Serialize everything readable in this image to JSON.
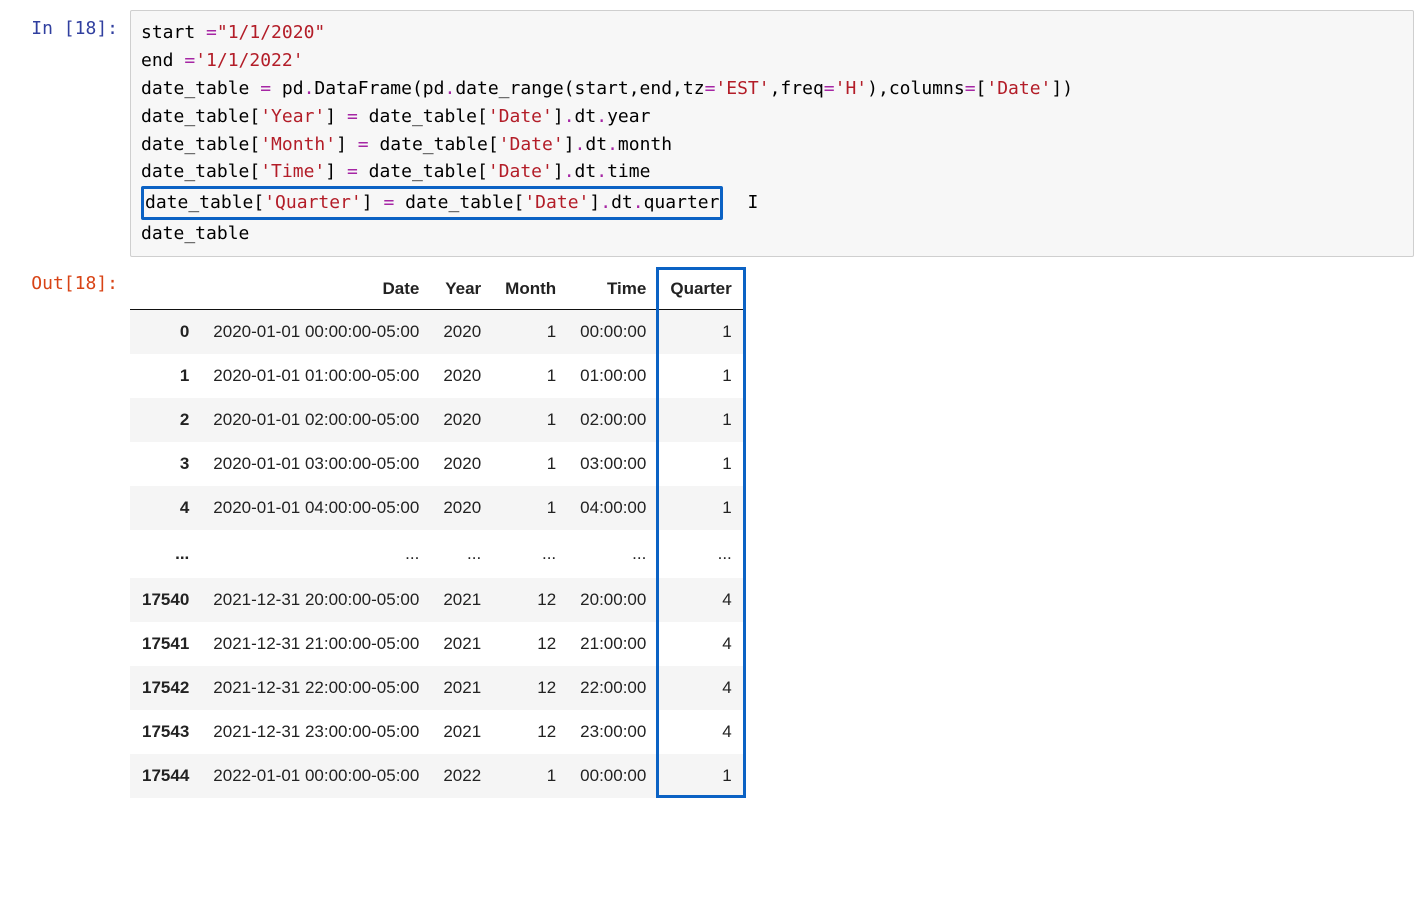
{
  "cell": {
    "exec_count": "18",
    "in_prefix": "In [",
    "in_suffix": "]:",
    "out_prefix": "Out[",
    "out_suffix": "]:"
  },
  "code": {
    "l1_a": "start ",
    "l1_b": "=",
    "l1_c": "\"1/1/2020\"",
    "l2_a": "end ",
    "l2_b": "=",
    "l2_c": "'1/1/2022'",
    "l3_a": "date_table ",
    "l3_b": "=",
    "l3_c": " pd",
    "l3_d": ".",
    "l3_e": "DataFrame(pd",
    "l3_f": ".",
    "l3_g": "date_range(start,end,tz",
    "l3_h": "=",
    "l3_i": "'EST'",
    "l3_j": ",freq",
    "l3_k": "=",
    "l3_l": "'H'",
    "l3_m": "),columns",
    "l3_n": "=",
    "l3_o": "[",
    "l3_p": "'Date'",
    "l3_q": "])",
    "l4_a": "date_table[",
    "l4_b": "'Year'",
    "l4_c": "] ",
    "l4_d": "=",
    "l4_e": " date_table[",
    "l4_f": "'Date'",
    "l4_g": "]",
    "l4_h": ".",
    "l4_i": "dt",
    "l4_j": ".",
    "l4_k": "year",
    "l5_a": "date_table[",
    "l5_b": "'Month'",
    "l5_c": "] ",
    "l5_d": "=",
    "l5_e": " date_table[",
    "l5_f": "'Date'",
    "l5_g": "]",
    "l5_h": ".",
    "l5_i": "dt",
    "l5_j": ".",
    "l5_k": "month",
    "l6_a": "date_table[",
    "l6_b": "'Time'",
    "l6_c": "] ",
    "l6_d": "=",
    "l6_e": " date_table[",
    "l6_f": "'Date'",
    "l6_g": "]",
    "l6_h": ".",
    "l6_i": "dt",
    "l6_j": ".",
    "l6_k": "time",
    "l7_a": "date_table[",
    "l7_b": "'Quarter'",
    "l7_c": "] ",
    "l7_d": "=",
    "l7_e": " date_table[",
    "l7_f": "'Date'",
    "l7_g": "]",
    "l7_h": ".",
    "l7_i": "dt",
    "l7_j": ".",
    "l7_k": "quarter",
    "l8_a": "date_table",
    "cursor": "I"
  },
  "table": {
    "head0": "",
    "head1": "Date",
    "head2": "Year",
    "head3": "Month",
    "head4": "Time",
    "head5": "Quarter",
    "ell": "...",
    "rows": [
      {
        "idx": "0",
        "date": "2020-01-01 00:00:00-05:00",
        "year": "2020",
        "month": "1",
        "time": "00:00:00",
        "quarter": "1"
      },
      {
        "idx": "1",
        "date": "2020-01-01 01:00:00-05:00",
        "year": "2020",
        "month": "1",
        "time": "01:00:00",
        "quarter": "1"
      },
      {
        "idx": "2",
        "date": "2020-01-01 02:00:00-05:00",
        "year": "2020",
        "month": "1",
        "time": "02:00:00",
        "quarter": "1"
      },
      {
        "idx": "3",
        "date": "2020-01-01 03:00:00-05:00",
        "year": "2020",
        "month": "1",
        "time": "03:00:00",
        "quarter": "1"
      },
      {
        "idx": "4",
        "date": "2020-01-01 04:00:00-05:00",
        "year": "2020",
        "month": "1",
        "time": "04:00:00",
        "quarter": "1"
      }
    ],
    "rows2": [
      {
        "idx": "17540",
        "date": "2021-12-31 20:00:00-05:00",
        "year": "2021",
        "month": "12",
        "time": "20:00:00",
        "quarter": "4"
      },
      {
        "idx": "17541",
        "date": "2021-12-31 21:00:00-05:00",
        "year": "2021",
        "month": "12",
        "time": "21:00:00",
        "quarter": "4"
      },
      {
        "idx": "17542",
        "date": "2021-12-31 22:00:00-05:00",
        "year": "2021",
        "month": "12",
        "time": "22:00:00",
        "quarter": "4"
      },
      {
        "idx": "17543",
        "date": "2021-12-31 23:00:00-05:00",
        "year": "2021",
        "month": "12",
        "time": "23:00:00",
        "quarter": "4"
      },
      {
        "idx": "17544",
        "date": "2022-01-01 00:00:00-05:00",
        "year": "2022",
        "month": "1",
        "time": "00:00:00",
        "quarter": "1"
      }
    ]
  }
}
